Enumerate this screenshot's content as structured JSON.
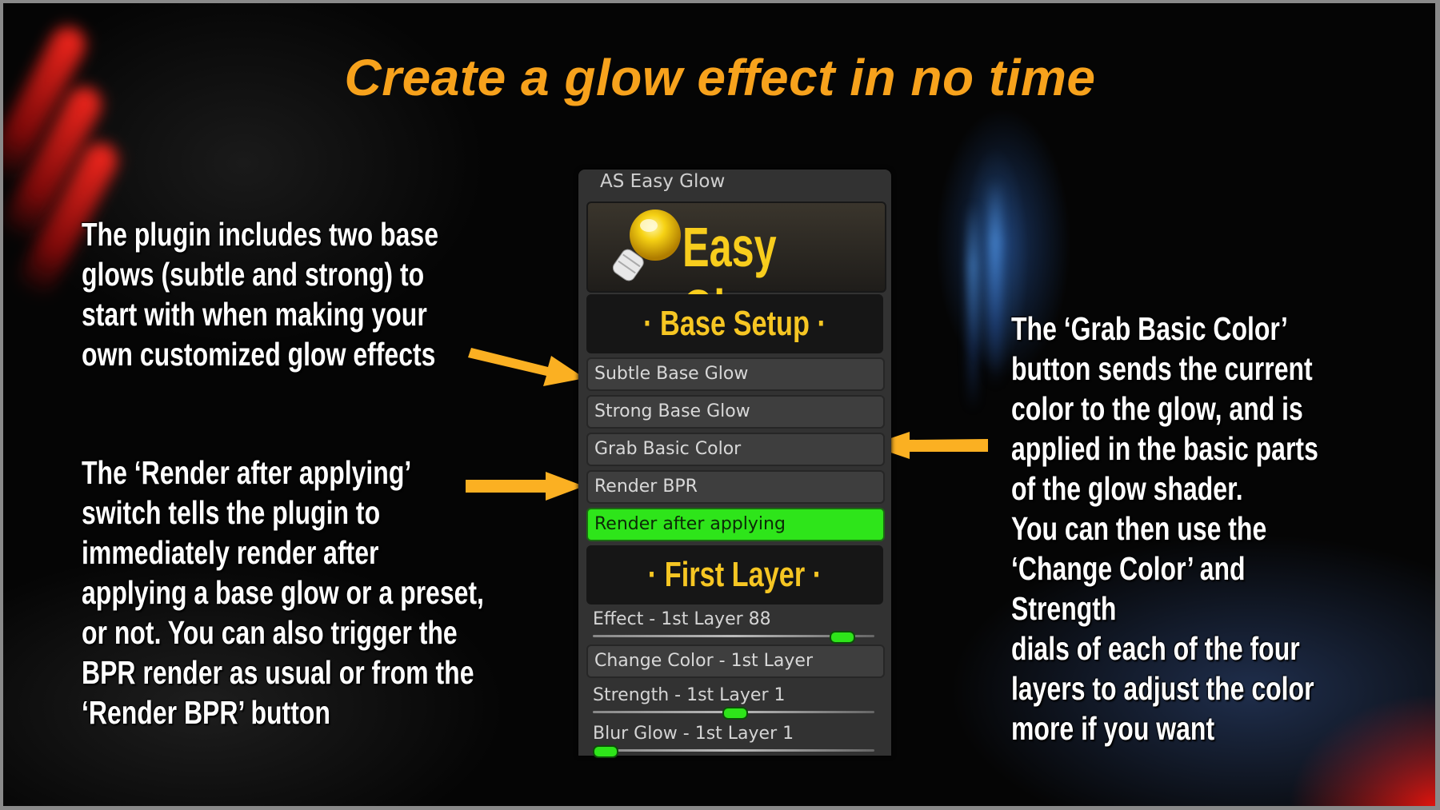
{
  "title": "Create a glow effect in no time",
  "colors": {
    "title": "#f7a21c",
    "arrow": "#fbb022",
    "section_text": "#f6c623",
    "toggle_on": "#2ee51a"
  },
  "captions": {
    "base_glows": "The plugin includes two base\nglows (subtle and strong) to\nstart with when making your\nown customized glow effects",
    "render_after": "The ‘Render after applying’\nswitch tells the plugin to\nimmediately render after\napplying a base glow or a preset,\nor not. You can also trigger the\nBPR render as usual or from the\n‘Render BPR’ button",
    "grab_color": "The ‘Grab Basic Color’\nbutton sends the current\ncolor to the glow, and is\napplied in the basic parts\nof the glow shader.\nYou can then use the\n‘Change Color’ and Strength\ndials of each of the four\nlayers to adjust the color\nmore if you want"
  },
  "panel": {
    "title": "AS Easy Glow",
    "logo_text": "Easy Glow",
    "logo_icon": "lightbulb-icon",
    "sections": {
      "base_setup": "· Base Setup ·",
      "first_layer": "· First Layer ·"
    },
    "buttons": {
      "subtle": "Subtle Base Glow",
      "strong": "Strong Base Glow",
      "grab": "Grab Basic Color",
      "render_bpr": "Render BPR",
      "render_after": "Render after applying",
      "change_color": "Change Color - 1st Layer"
    },
    "render_after_enabled": true,
    "sliders": [
      {
        "label": "Effect - 1st Layer",
        "value": "88",
        "fraction": 0.88
      },
      {
        "label": "Strength - 1st Layer",
        "value": "1",
        "fraction": 0.5
      },
      {
        "label": "Blur Glow - 1st Layer",
        "value": "1",
        "fraction": 0.0
      }
    ]
  }
}
